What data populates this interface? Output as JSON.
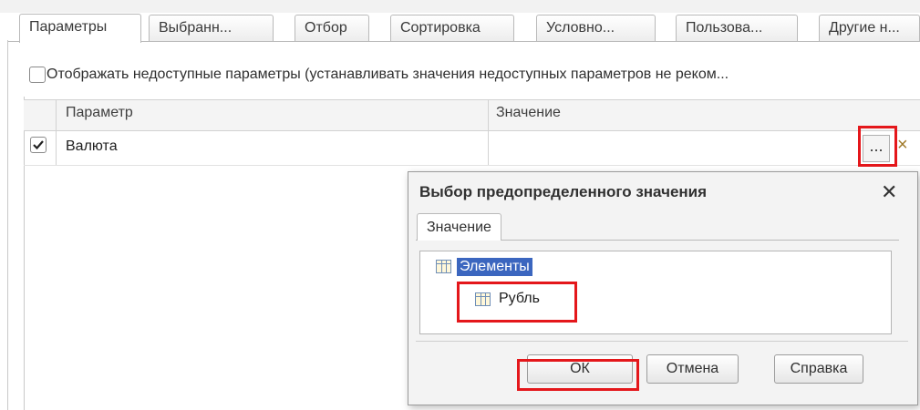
{
  "tabs": [
    "Параметры",
    "Выбранн...",
    "Отбор",
    "Сортировка",
    "Условно...",
    "Пользова...",
    "Другие н..."
  ],
  "show_unavailable": {
    "checked": false,
    "label": "Отображать недоступные параметры (устанавливать значения недоступных параметров не реком..."
  },
  "grid": {
    "columns": [
      "Параметр",
      "Значение"
    ],
    "rows": [
      {
        "checked": true,
        "parameter": "Валюта",
        "value": ""
      }
    ],
    "select_button": "...",
    "clear_button": "×"
  },
  "dialog": {
    "title": "Выбор предопределенного значения",
    "close_icon": "✕",
    "tab": "Значение",
    "tree": [
      {
        "label": "Элементы",
        "selected": true,
        "icon": "table-icon"
      },
      {
        "label": "Рубль",
        "selected": false,
        "icon": "table-icon"
      }
    ],
    "buttons": {
      "ok": "ОК",
      "cancel": "Отмена",
      "help": "Справка"
    }
  },
  "colors": {
    "highlight": "#e4171b",
    "selection": "#3b66bf"
  }
}
